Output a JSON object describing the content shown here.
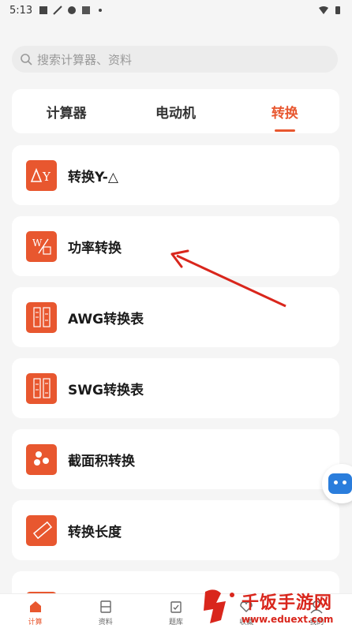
{
  "status_bar": {
    "time": "5:13"
  },
  "search": {
    "placeholder": "搜索计算器、资料"
  },
  "tabs": [
    {
      "label": "计算器",
      "active": false
    },
    {
      "label": "电动机",
      "active": false
    },
    {
      "label": "转换",
      "active": true
    }
  ],
  "cards": [
    {
      "label": "转换Y-△",
      "icon": "delta-y-icon"
    },
    {
      "label": "功率转换",
      "icon": "power-wa-icon"
    },
    {
      "label": "AWG转换表",
      "icon": "awg-ruler-icon"
    },
    {
      "label": "SWG转换表",
      "icon": "swg-ruler-icon"
    },
    {
      "label": "截面积转换",
      "icon": "cross-section-icon"
    },
    {
      "label": "转换长度",
      "icon": "ruler-icon"
    }
  ],
  "bottom_nav": [
    {
      "label": "计算",
      "icon": "home-icon",
      "active": true
    },
    {
      "label": "资料",
      "icon": "book-icon",
      "active": false
    },
    {
      "label": "题库",
      "icon": "clipboard-icon",
      "active": false
    },
    {
      "label": "收藏",
      "icon": "heart-icon",
      "active": false
    },
    {
      "label": "我的",
      "icon": "user-icon",
      "active": false
    }
  ],
  "watermark": {
    "title": "千饭手游网",
    "url": "www.eduext.com"
  },
  "colors": {
    "accent": "#e8572f",
    "background": "#f5f5f5",
    "bot": "#2a7ddc",
    "watermark": "#d9261c"
  }
}
